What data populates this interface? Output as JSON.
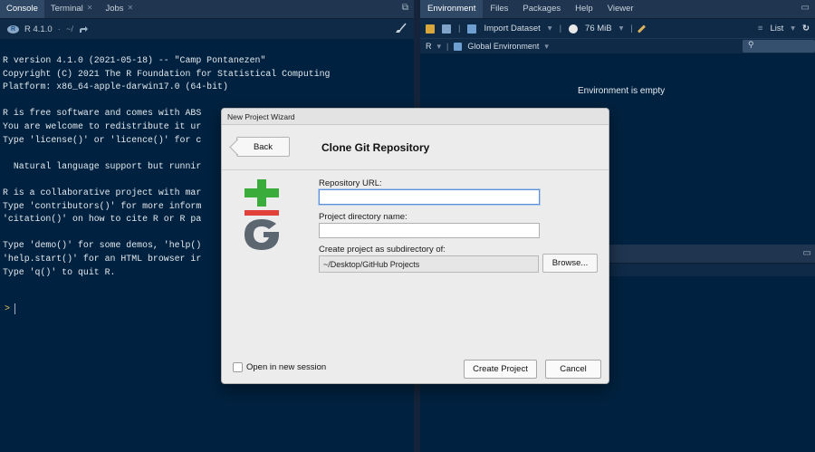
{
  "console_pane": {
    "tabs": [
      {
        "label": "Console",
        "closable": false
      },
      {
        "label": "Terminal",
        "closable": true
      },
      {
        "label": "Jobs",
        "closable": true
      }
    ],
    "r_version_label": "R 4.1.0",
    "working_dir": "~/",
    "output_lines": [
      "R version 4.1.0 (2021-05-18) -- \"Camp Pontanezen\"",
      "Copyright (C) 2021 The R Foundation for Statistical Computing",
      "Platform: x86_64-apple-darwin17.0 (64-bit)",
      "",
      "R is free software and comes with ABS",
      "You are welcome to redistribute it ur",
      "Type 'license()' or 'licence()' for c",
      "",
      "  Natural language support but runnir",
      "",
      "R is a collaborative project with mar",
      "Type 'contributors()' for more inform",
      "'citation()' on how to cite R or R pa",
      "",
      "Type 'demo()' for some demos, 'help()",
      "'help.start()' for an HTML browser ir",
      "Type 'q()' to quit R."
    ],
    "prompt": ">"
  },
  "env_pane": {
    "tabs": [
      "Environment",
      "Files",
      "Packages",
      "Help",
      "Viewer"
    ],
    "toolbar": {
      "import_label": "Import Dataset",
      "memory_label": "76 MiB",
      "view_label": "List"
    },
    "language_label": "R",
    "scope_label": "Global Environment",
    "empty_message": "Environment is empty"
  },
  "dialog": {
    "window_title": "New Project Wizard",
    "back_label": "Back",
    "title": "Clone Git Repository",
    "repo_url_label": "Repository URL:",
    "repo_url_value": "",
    "dir_name_label": "Project directory name:",
    "dir_name_value": "",
    "subdir_label": "Create project as subdirectory of:",
    "subdir_value": "~/Desktop/GitHub Projects",
    "browse_label": "Browse...",
    "open_new_session_label": "Open in new session",
    "create_label": "Create Project",
    "cancel_label": "Cancel"
  },
  "colors": {
    "git_green": "#3aac3c",
    "git_red": "#e2403a",
    "git_gray": "#5b6670"
  }
}
